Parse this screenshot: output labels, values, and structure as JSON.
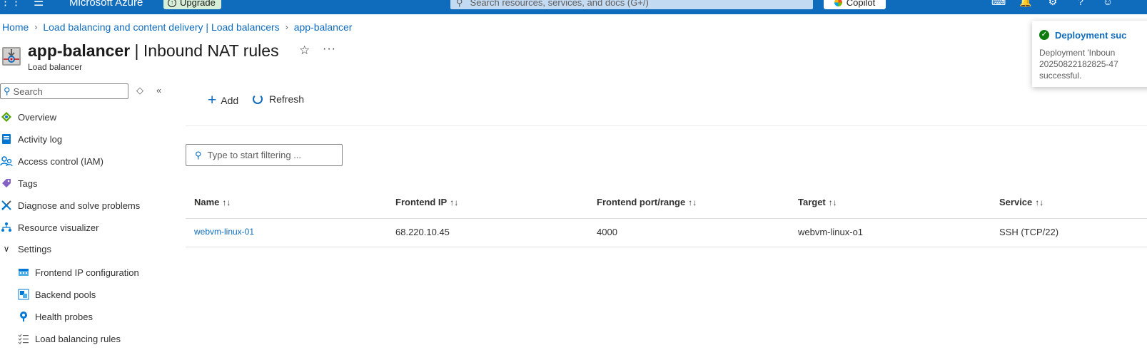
{
  "topbar": {
    "brand": "Microsoft Azure",
    "upgrade_label": "Upgrade",
    "search_placeholder": "Search resources, services, and docs (G+/)",
    "copilot_label": "Copilot"
  },
  "breadcrumb": [
    "Home",
    "Load balancing and content delivery | Load balancers",
    "app-balancer"
  ],
  "header": {
    "resource_name": "app-balancer",
    "separator": " | ",
    "page_name": "Inbound NAT rules",
    "subtitle": "Load balancer"
  },
  "sidebar": {
    "search_placeholder": "Search",
    "items": [
      {
        "label": "Overview",
        "icon": "overview-icon"
      },
      {
        "label": "Activity log",
        "icon": "activity-log-icon"
      },
      {
        "label": "Access control (IAM)",
        "icon": "iam-icon"
      },
      {
        "label": "Tags",
        "icon": "tag-icon"
      },
      {
        "label": "Diagnose and solve problems",
        "icon": "wrench-icon"
      },
      {
        "label": "Resource visualizer",
        "icon": "visualizer-icon"
      },
      {
        "label": "Settings",
        "icon": "chevron-down-icon"
      }
    ],
    "sub_items": [
      {
        "label": "Frontend IP configuration",
        "icon": "frontend-ip-icon"
      },
      {
        "label": "Backend pools",
        "icon": "backend-pool-icon"
      },
      {
        "label": "Health probes",
        "icon": "health-probe-icon"
      },
      {
        "label": "Load balancing rules",
        "icon": "rules-icon"
      }
    ]
  },
  "toolbar": {
    "add_label": "Add",
    "refresh_label": "Refresh"
  },
  "filter": {
    "placeholder": "Type to start filtering ..."
  },
  "table": {
    "columns": [
      "Name",
      "Frontend IP",
      "Frontend port/range",
      "Target",
      "Service"
    ],
    "rows": [
      [
        "webvm-linux-01",
        "68.220.10.45",
        "4000",
        "webvm-linux-o1",
        "SSH (TCP/22)"
      ]
    ]
  },
  "toast": {
    "title": "Deployment suc",
    "message_lines": [
      "Deployment 'Inboun",
      "20250822182825-47",
      "successful."
    ]
  },
  "colors": {
    "accent": "#0f6cbd",
    "success": "#107c10"
  }
}
